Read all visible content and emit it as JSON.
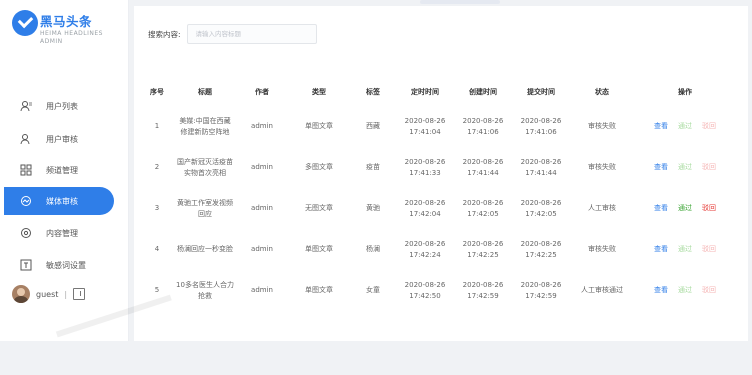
{
  "brand": {
    "title": "黑马头条",
    "subtitle": "HEIMA HEADLINES ADMIN",
    "accent": "#2f7ee8"
  },
  "sidebar": {
    "items": [
      {
        "label": "用户列表",
        "icon": "user-list-icon"
      },
      {
        "label": "用户审核",
        "icon": "user-audit-icon"
      },
      {
        "label": "频道管理",
        "icon": "channel-icon"
      },
      {
        "label": "媒体审核",
        "icon": "media-audit-icon",
        "active": true
      },
      {
        "label": "内容管理",
        "icon": "content-icon"
      },
      {
        "label": "敏感词设置",
        "icon": "sensitive-word-icon"
      }
    ],
    "user": {
      "name": "guest",
      "separator": "|",
      "logout_icon": "logout-icon"
    }
  },
  "search": {
    "label": "搜索内容:",
    "placeholder": "请输入内容标题"
  },
  "table": {
    "headers": [
      "序号",
      "标题",
      "作者",
      "类型",
      "标签",
      "定时时间",
      "创建时间",
      "提交时间",
      "状态",
      "操作"
    ],
    "actions": {
      "view": "查看",
      "pass": "通过",
      "reject": "驳回"
    },
    "rows": [
      {
        "no": "1",
        "title": "美媒:中国在西藏修建新防空阵地",
        "author": "admin",
        "type": "单图文章",
        "tag": "西藏",
        "scheduled": "2020-08-26 17:41:04",
        "created": "2020-08-26 17:41:06",
        "submitted": "2020-08-26 17:41:06",
        "status": "审核失败",
        "actions_enabled": false
      },
      {
        "no": "2",
        "title": "国产新冠灭活疫苗实物首次亮相",
        "author": "admin",
        "type": "多图文章",
        "tag": "疫苗",
        "scheduled": "2020-08-26 17:41:33",
        "created": "2020-08-26 17:41:44",
        "submitted": "2020-08-26 17:41:44",
        "status": "审核失败",
        "actions_enabled": false
      },
      {
        "no": "3",
        "title": "黄驰工作室发视频回应",
        "author": "admin",
        "type": "无图文章",
        "tag": "黄驰",
        "scheduled": "2020-08-26 17:42:04",
        "created": "2020-08-26 17:42:05",
        "submitted": "2020-08-26 17:42:05",
        "status": "人工审核",
        "actions_enabled": true
      },
      {
        "no": "4",
        "title": "杨澜回应一秒变脸",
        "author": "admin",
        "type": "单图文章",
        "tag": "杨澜",
        "scheduled": "2020-08-26 17:42:24",
        "created": "2020-08-26 17:42:25",
        "submitted": "2020-08-26 17:42:25",
        "status": "审核失败",
        "actions_enabled": false
      },
      {
        "no": "5",
        "title": "10多名医生人合力抢救",
        "author": "admin",
        "type": "单图文章",
        "tag": "女童",
        "scheduled": "2020-08-26 17:42:50",
        "created": "2020-08-26 17:42:59",
        "submitted": "2020-08-26 17:42:59",
        "status": "人工审核通过",
        "actions_enabled": false
      }
    ]
  }
}
